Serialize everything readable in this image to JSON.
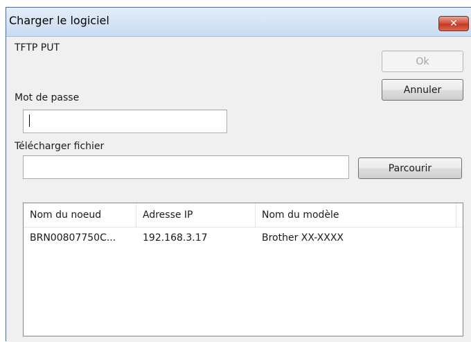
{
  "window": {
    "title": "Charger le logiciel",
    "close_symbol": "✕"
  },
  "dialog": {
    "protocol_label": "TFTP PUT",
    "password_label": "Mot de passe",
    "password_value": "",
    "upload_label": "Télécharger fichier",
    "upload_value": "",
    "ok_label": "Ok",
    "cancel_label": "Annuler",
    "browse_label": "Parcourir"
  },
  "device_list": {
    "columns": [
      "Nom du noeud",
      "Adresse IP",
      "Nom du modèle"
    ],
    "rows": [
      {
        "node_name": "BRN00807750C...",
        "ip_address": "192.168.3.17",
        "model_name": "Brother XX-XXXX"
      }
    ]
  },
  "icons": {
    "close": "close-icon"
  },
  "colors": {
    "titlebar": "#c9dcf2",
    "close_button": "#c23a22",
    "window_bg": "#f0f0f0"
  }
}
